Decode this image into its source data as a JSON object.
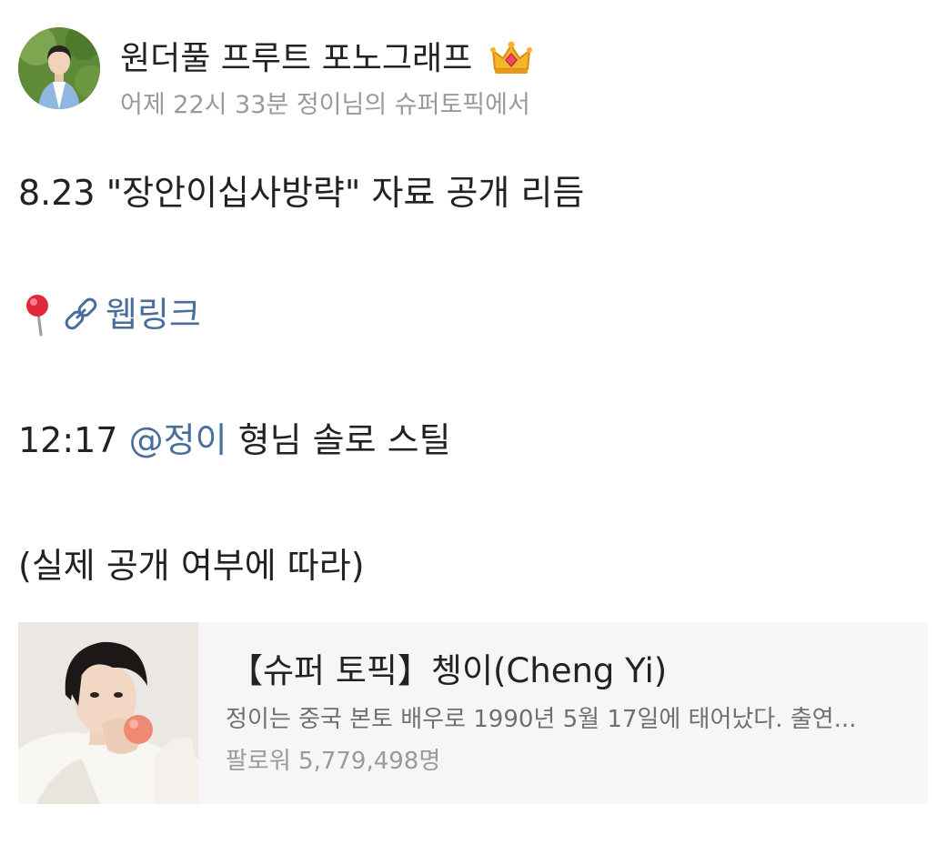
{
  "header": {
    "username": "원더풀 프루트 포노그래프",
    "meta": "어제 22시 33분 정이님의 슈퍼토픽에서",
    "crown_icon": "crown-icon"
  },
  "post": {
    "line1": "8.23 \"장안이십사방략\" 자료 공개 리듬",
    "link_label": "웹링크",
    "line3_time": "12:17",
    "line3_mention": "@정이",
    "line3_rest": "형님 솔로 스틸",
    "line4": "(실제 공개 여부에 따라)"
  },
  "card": {
    "title": "【슈퍼 토픽】쳉이(Cheng Yi)",
    "description": "정이는 중국 본토 배우로 1990년 5월 17일에 태어났다. 출연...",
    "followers": "팔로워 5,779,498명"
  },
  "colors": {
    "link": "#4a6e9c",
    "meta": "#9a9a9a",
    "card_bg": "#f6f6f6"
  }
}
